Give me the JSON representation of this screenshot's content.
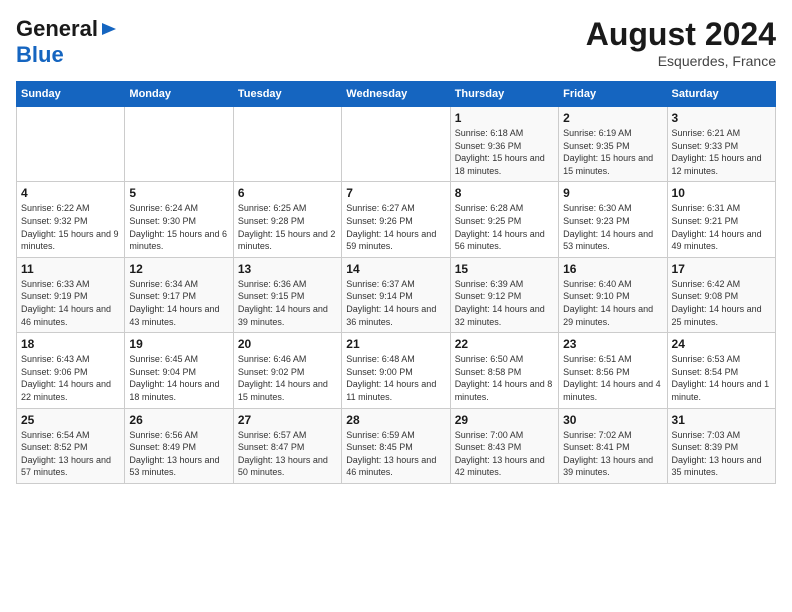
{
  "logo": {
    "line1": "General",
    "line2": "Blue"
  },
  "header": {
    "month_year": "August 2024",
    "location": "Esquerdes, France"
  },
  "days_of_week": [
    "Sunday",
    "Monday",
    "Tuesday",
    "Wednesday",
    "Thursday",
    "Friday",
    "Saturday"
  ],
  "weeks": [
    [
      {
        "day": "",
        "info": ""
      },
      {
        "day": "",
        "info": ""
      },
      {
        "day": "",
        "info": ""
      },
      {
        "day": "",
        "info": ""
      },
      {
        "day": "1",
        "info": "Sunrise: 6:18 AM\nSunset: 9:36 PM\nDaylight: 15 hours\nand 18 minutes."
      },
      {
        "day": "2",
        "info": "Sunrise: 6:19 AM\nSunset: 9:35 PM\nDaylight: 15 hours\nand 15 minutes."
      },
      {
        "day": "3",
        "info": "Sunrise: 6:21 AM\nSunset: 9:33 PM\nDaylight: 15 hours\nand 12 minutes."
      }
    ],
    [
      {
        "day": "4",
        "info": "Sunrise: 6:22 AM\nSunset: 9:32 PM\nDaylight: 15 hours\nand 9 minutes."
      },
      {
        "day": "5",
        "info": "Sunrise: 6:24 AM\nSunset: 9:30 PM\nDaylight: 15 hours\nand 6 minutes."
      },
      {
        "day": "6",
        "info": "Sunrise: 6:25 AM\nSunset: 9:28 PM\nDaylight: 15 hours\nand 2 minutes."
      },
      {
        "day": "7",
        "info": "Sunrise: 6:27 AM\nSunset: 9:26 PM\nDaylight: 14 hours\nand 59 minutes."
      },
      {
        "day": "8",
        "info": "Sunrise: 6:28 AM\nSunset: 9:25 PM\nDaylight: 14 hours\nand 56 minutes."
      },
      {
        "day": "9",
        "info": "Sunrise: 6:30 AM\nSunset: 9:23 PM\nDaylight: 14 hours\nand 53 minutes."
      },
      {
        "day": "10",
        "info": "Sunrise: 6:31 AM\nSunset: 9:21 PM\nDaylight: 14 hours\nand 49 minutes."
      }
    ],
    [
      {
        "day": "11",
        "info": "Sunrise: 6:33 AM\nSunset: 9:19 PM\nDaylight: 14 hours\nand 46 minutes."
      },
      {
        "day": "12",
        "info": "Sunrise: 6:34 AM\nSunset: 9:17 PM\nDaylight: 14 hours\nand 43 minutes."
      },
      {
        "day": "13",
        "info": "Sunrise: 6:36 AM\nSunset: 9:15 PM\nDaylight: 14 hours\nand 39 minutes."
      },
      {
        "day": "14",
        "info": "Sunrise: 6:37 AM\nSunset: 9:14 PM\nDaylight: 14 hours\nand 36 minutes."
      },
      {
        "day": "15",
        "info": "Sunrise: 6:39 AM\nSunset: 9:12 PM\nDaylight: 14 hours\nand 32 minutes."
      },
      {
        "day": "16",
        "info": "Sunrise: 6:40 AM\nSunset: 9:10 PM\nDaylight: 14 hours\nand 29 minutes."
      },
      {
        "day": "17",
        "info": "Sunrise: 6:42 AM\nSunset: 9:08 PM\nDaylight: 14 hours\nand 25 minutes."
      }
    ],
    [
      {
        "day": "18",
        "info": "Sunrise: 6:43 AM\nSunset: 9:06 PM\nDaylight: 14 hours\nand 22 minutes."
      },
      {
        "day": "19",
        "info": "Sunrise: 6:45 AM\nSunset: 9:04 PM\nDaylight: 14 hours\nand 18 minutes."
      },
      {
        "day": "20",
        "info": "Sunrise: 6:46 AM\nSunset: 9:02 PM\nDaylight: 14 hours\nand 15 minutes."
      },
      {
        "day": "21",
        "info": "Sunrise: 6:48 AM\nSunset: 9:00 PM\nDaylight: 14 hours\nand 11 minutes."
      },
      {
        "day": "22",
        "info": "Sunrise: 6:50 AM\nSunset: 8:58 PM\nDaylight: 14 hours\nand 8 minutes."
      },
      {
        "day": "23",
        "info": "Sunrise: 6:51 AM\nSunset: 8:56 PM\nDaylight: 14 hours\nand 4 minutes."
      },
      {
        "day": "24",
        "info": "Sunrise: 6:53 AM\nSunset: 8:54 PM\nDaylight: 14 hours\nand 1 minute."
      }
    ],
    [
      {
        "day": "25",
        "info": "Sunrise: 6:54 AM\nSunset: 8:52 PM\nDaylight: 13 hours\nand 57 minutes."
      },
      {
        "day": "26",
        "info": "Sunrise: 6:56 AM\nSunset: 8:49 PM\nDaylight: 13 hours\nand 53 minutes."
      },
      {
        "day": "27",
        "info": "Sunrise: 6:57 AM\nSunset: 8:47 PM\nDaylight: 13 hours\nand 50 minutes."
      },
      {
        "day": "28",
        "info": "Sunrise: 6:59 AM\nSunset: 8:45 PM\nDaylight: 13 hours\nand 46 minutes."
      },
      {
        "day": "29",
        "info": "Sunrise: 7:00 AM\nSunset: 8:43 PM\nDaylight: 13 hours\nand 42 minutes."
      },
      {
        "day": "30",
        "info": "Sunrise: 7:02 AM\nSunset: 8:41 PM\nDaylight: 13 hours\nand 39 minutes."
      },
      {
        "day": "31",
        "info": "Sunrise: 7:03 AM\nSunset: 8:39 PM\nDaylight: 13 hours\nand 35 minutes."
      }
    ]
  ]
}
